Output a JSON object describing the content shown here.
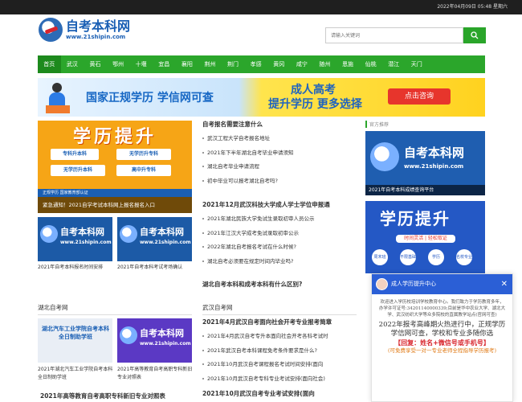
{
  "topbar": {
    "datetime": "2022年04月09日 05:48 星期六"
  },
  "header": {
    "logo_title": "自考本科网",
    "logo_url": "www.21shipin.com",
    "search_placeholder": "请输入关键词",
    "search_icon": "search-icon"
  },
  "nav": {
    "items": [
      "首页",
      "武汉",
      "黄石",
      "鄂州",
      "十堰",
      "宜昌",
      "襄阳",
      "荆州",
      "荆门",
      "孝感",
      "黄冈",
      "咸宁",
      "随州",
      "恩施",
      "仙桃",
      "潜江",
      "天门"
    ]
  },
  "banner": {
    "left_text": "国家正规学历 学信网可查",
    "title": "成人高考",
    "subtitle": "提升学历 更多选择",
    "button": "点击咨询"
  },
  "promo": {
    "title": "学历提升",
    "chips": [
      "专科升本科",
      "无学历升专科",
      "无学历升本科",
      "高中升专科"
    ],
    "bar": "正规学历  国家教育部认证",
    "caption": "紧急通知！2021自学考试本科网上报名报名入口"
  },
  "thumbs": {
    "t1": {
      "title": "自考本科网",
      "url": "www.21shipin.com",
      "caption": "2021年自考本科报名时间安排"
    },
    "t2": {
      "title": "自考本科网",
      "url": "www.21shipin.com",
      "caption": "2021年自考本科考试考场确认"
    },
    "t3": {
      "title": "湖北汽车工业学院自考本科全日制助学班",
      "caption": "2021年湖北汽车工业学院自考本科全日制助学班"
    },
    "t4": {
      "title": "自考本科网",
      "url": "www.21shipin.com",
      "caption": "2021年高等教育自考高职专科新旧专业对照表"
    }
  },
  "middle": {
    "group1": [
      {
        "text": "自考报名需要注意什么",
        "strong": true
      },
      {
        "text": "武汉工程大学自考报名地址",
        "strong": false
      },
      {
        "text": "2021年下半年湖北自考毕业申请须知",
        "strong": false
      },
      {
        "text": "湖北自考毕业申请流程",
        "strong": false
      },
      {
        "text": "初中毕业可以报考湖北自考吗?",
        "strong": false
      }
    ],
    "group2": [
      {
        "text": "2021年12月武汉科技大学成人学士学位申报通",
        "strong": true
      },
      {
        "text": "2021年湖北民族大学免试生录取初审人员公示",
        "strong": false
      },
      {
        "text": "2021年江汉大学成考免试录取初审公示",
        "strong": false
      },
      {
        "text": "2022年湖北自考报名考试在什么时候?",
        "strong": false
      },
      {
        "text": "湖北自考必须要在规定时间内毕业吗?",
        "strong": false
      }
    ],
    "group3": [
      {
        "text": "湖北自考本科和成考本科有什么区别?",
        "strong": true
      }
    ]
  },
  "sections": {
    "hubei": {
      "title": "湖北自考网"
    },
    "wuhan": {
      "title": "武汉自考网",
      "items": [
        {
          "text": "2021年4月武汉自考面向社会开考专业报考简章",
          "strong": true
        },
        {
          "text": "2021年4月武汉自考专升本面向社会开考各科考试时",
          "strong": false
        },
        {
          "text": "2021年武汉自考本科课程免考条件要求是什么?",
          "strong": false
        },
        {
          "text": "2021年10月武汉自考课程报名考试时间安排(面向",
          "strong": false
        },
        {
          "text": "2021年10月武汉自考专科专业考试安排(面向社会)",
          "strong": false
        },
        {
          "text": "2021年10月武汉自考专业考试安排(面向",
          "strong": true
        }
      ]
    },
    "bottom_left": "2021年高等教育自考高职专科新旧专业对照表"
  },
  "sidebar": {
    "label": "官方推荐",
    "ad1_title": "自考本科网",
    "ad1_url": "www.21shipin.com",
    "ad1_caption": "2021年自考本科成绩查询平台",
    "ad2_title": "学历提升",
    "ad2_sub": "时间灵活 | 轻松取证",
    "ad2_circles": [
      "周末班",
      "不限基础",
      "学历",
      "名校专业"
    ]
  },
  "chat": {
    "title": "成人学历提升中心",
    "intro": "欢迎进入学历校培训学校教育中心。我们致力于学历教育多年，办学许可证号:34201140000339;目前是华中农业大学、湖北大学、武汉纺织大学等众多院校的直属教学站点(官网可查)",
    "headline": "2022年报考高峰期火热进行中，正规学历学信网可查，学校和专业多随你选",
    "reply": "【回复：姓名+微信号或手机号】",
    "note": "(可免费享受一对一专业老师全程指导学历报考)"
  }
}
